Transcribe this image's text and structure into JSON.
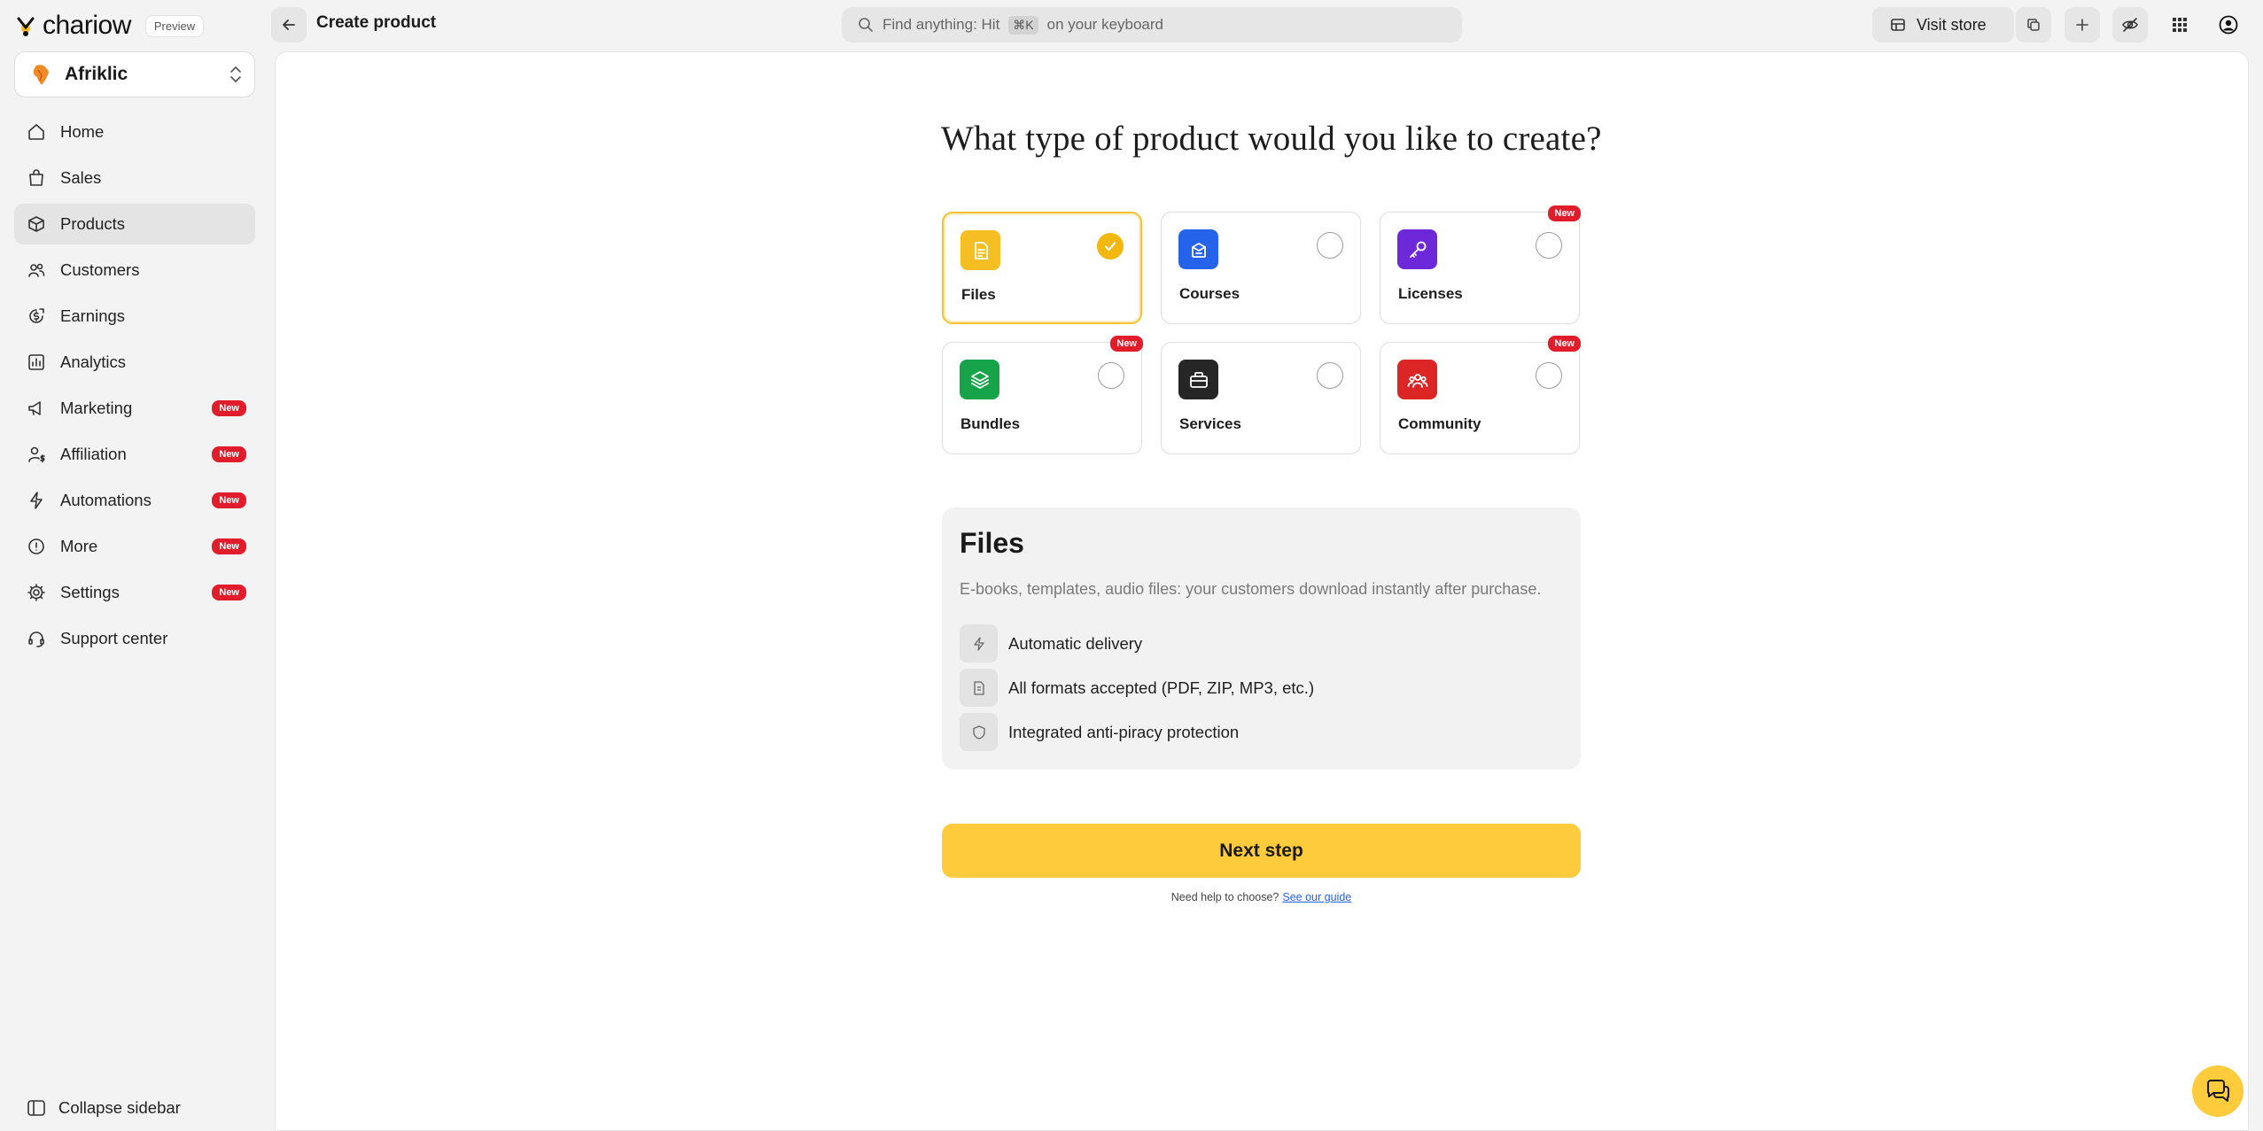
{
  "brand": {
    "name": "chariow",
    "preview_label": "Preview"
  },
  "header": {
    "page_title": "Create product",
    "search_placeholder_prefix": "Find anything: Hit",
    "search_shortcut": "⌘K",
    "search_placeholder_suffix": "on your keyboard",
    "visit_store_label": "Visit store"
  },
  "workspace": {
    "name": "Afriklic"
  },
  "sidebar": {
    "items": [
      {
        "label": "Home",
        "icon": "home-icon",
        "badge": ""
      },
      {
        "label": "Sales",
        "icon": "shopping-bag-icon",
        "badge": ""
      },
      {
        "label": "Products",
        "icon": "box-icon",
        "badge": "",
        "active": true
      },
      {
        "label": "Customers",
        "icon": "users-icon",
        "badge": ""
      },
      {
        "label": "Earnings",
        "icon": "earnings-icon",
        "badge": ""
      },
      {
        "label": "Analytics",
        "icon": "chart-icon",
        "badge": ""
      },
      {
        "label": "Marketing",
        "icon": "megaphone-icon",
        "badge": "New"
      },
      {
        "label": "Affiliation",
        "icon": "user-dollar-icon",
        "badge": "New"
      },
      {
        "label": "Automations",
        "icon": "lightning-icon",
        "badge": "New"
      },
      {
        "label": "More",
        "icon": "more-icon",
        "badge": "New"
      },
      {
        "label": "Settings",
        "icon": "gear-icon",
        "badge": "New"
      },
      {
        "label": "Support center",
        "icon": "headset-icon",
        "badge": ""
      }
    ],
    "collapse_label": "Collapse sidebar"
  },
  "main": {
    "title": "What type of product would you like to create?",
    "types": [
      {
        "label": "Files",
        "icon": "file-icon",
        "color": "#F5BE23",
        "selected": true,
        "badge": ""
      },
      {
        "label": "Courses",
        "icon": "course-icon",
        "color": "#2563EB",
        "selected": false,
        "badge": ""
      },
      {
        "label": "Licenses",
        "icon": "key-icon",
        "color": "#6D28D9",
        "selected": false,
        "badge": "New"
      },
      {
        "label": "Bundles",
        "icon": "layers-icon",
        "color": "#16A34A",
        "selected": false,
        "badge": "New"
      },
      {
        "label": "Services",
        "icon": "briefcase-icon",
        "color": "#262626",
        "selected": false,
        "badge": ""
      },
      {
        "label": "Community",
        "icon": "community-icon",
        "color": "#DC2626",
        "selected": false,
        "badge": "New"
      }
    ],
    "detail": {
      "title": "Files",
      "description": "E-books, templates, audio files: your customers download instantly after purchase.",
      "features": [
        "Automatic delivery",
        "All formats accepted (PDF, ZIP, MP3, etc.)",
        "Integrated anti-piracy protection"
      ]
    },
    "next_button": "Next step",
    "help_text": "Need help to choose?",
    "help_link": "See our guide"
  },
  "colors": {
    "accent": "#FDCB3B",
    "badge": "#E11D2C",
    "link": "#2563EB"
  }
}
